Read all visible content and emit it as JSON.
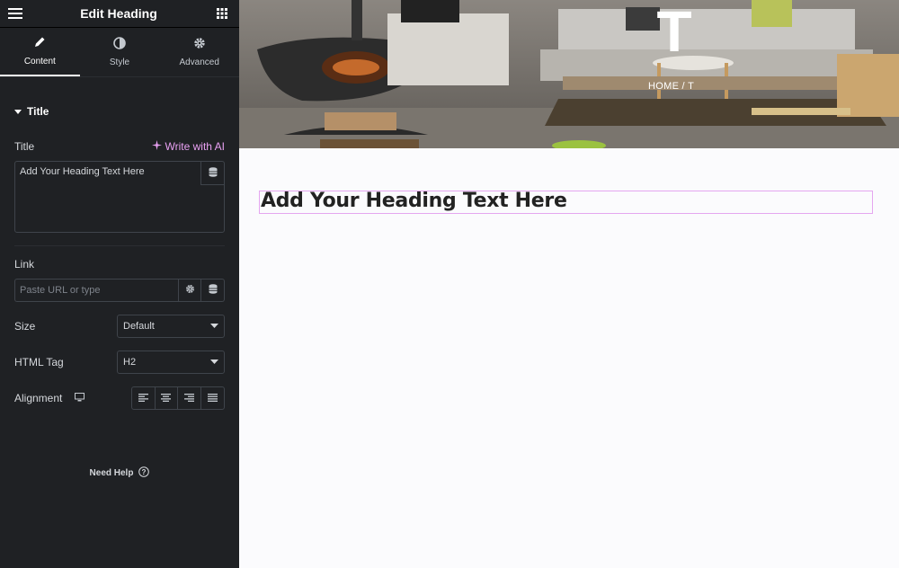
{
  "header": {
    "title": "Edit Heading"
  },
  "tabs": [
    {
      "label": "Content"
    },
    {
      "label": "Style"
    },
    {
      "label": "Advanced"
    }
  ],
  "section": {
    "title": "Title"
  },
  "title_field": {
    "label": "Title",
    "ai_label": "Write with AI",
    "value": "Add Your Heading Text Here"
  },
  "link_field": {
    "label": "Link",
    "placeholder": "Paste URL or type"
  },
  "size_field": {
    "label": "Size",
    "value": "Default"
  },
  "html_tag_field": {
    "label": "HTML Tag",
    "value": "H2"
  },
  "alignment_field": {
    "label": "Alignment"
  },
  "help": {
    "label": "Need Help"
  },
  "preview": {
    "hero_title": "T",
    "breadcrumb": "HOME  /  T",
    "heading": "Add Your Heading Text Here"
  },
  "colors": {
    "panel_bg": "#1f2124",
    "accent_ai": "#e9a1f3",
    "heading_outline": "#e5a6f0"
  }
}
